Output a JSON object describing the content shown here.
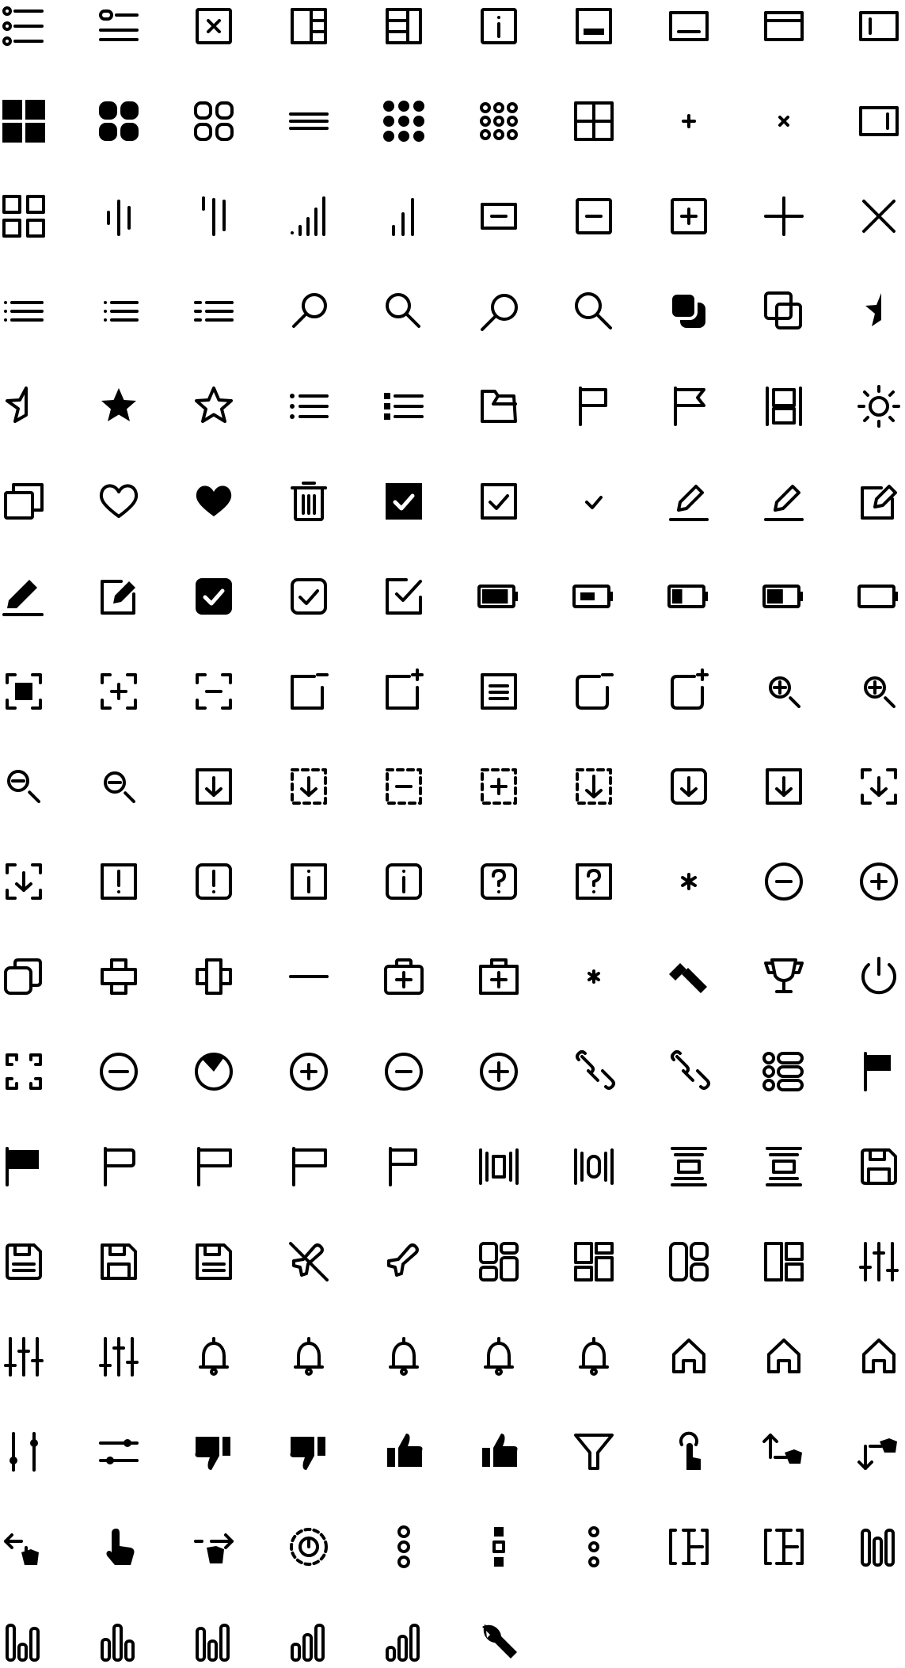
{
  "sheet": {
    "background": "#ffffff",
    "ink": "#000000",
    "icons": [
      "list-bulleted-icon",
      "list-header-icon",
      "close-box-icon",
      "layout-columns-icon",
      "layout-sidebar-icon",
      "info-box-icon",
      "panel-bottom-icon",
      "panel-bottom-outline-icon",
      "panel-top-icon",
      "panel-left-icon",
      "grid-filled-icon",
      "grid-rounded-filled-icon",
      "grid-rounded-outline-icon",
      "lines-icon",
      "grid-dots-filled-icon",
      "grid-dots-outline-icon",
      "grid-window-icon",
      "plus-small-icon",
      "close-small-icon",
      "panel-right-icon",
      "grid-outline-icon",
      "signal-low-icon",
      "signal-off-icon",
      "signal-bars-icon",
      "signal-bars-partial-icon",
      "minus-rect-icon",
      "minus-square-icon",
      "plus-square-icon",
      "plus-icon",
      "close-icon",
      "list-compact-icon",
      "list-dotted-icon",
      "list-dashed-icon",
      "search-left-icon",
      "search-right-icon",
      "search-left-large-icon",
      "search-right-large-icon",
      "copy-filled-icon",
      "copy-outline-icon",
      "star-half-filled-icon",
      "star-half-outline-icon",
      "star-filled-icon",
      "star-outline-icon",
      "list-bullets-icon",
      "list-bullets-bold-icon",
      "folder-open-icon",
      "flag-outline-icon",
      "flag-notch-icon",
      "layout-split-icon",
      "settings-sun-icon",
      "copy-stack-icon",
      "heart-outline-icon",
      "heart-filled-icon",
      "trash-icon",
      "checkbox-filled-icon",
      "checkbox-outline-icon",
      "check-icon",
      "pencil-underline-icon",
      "pencil-line-icon",
      "edit-square-icon",
      "pencil-filled-icon",
      "edit-box-icon",
      "checkbox-rounded-filled-icon",
      "checkbox-rounded-outline-icon",
      "checkbox-open-icon",
      "battery-filled-icon",
      "battery-half-icon",
      "battery-low-icon",
      "battery-mid-icon",
      "battery-empty-icon",
      "focus-square-icon",
      "focus-plus-icon",
      "focus-minus-icon",
      "window-minus-icon",
      "window-plus-icon",
      "document-lines-icon",
      "window-minus-rounded-icon",
      "window-plus-rounded-icon",
      "zoom-in-icon",
      "zoom-in-alt-icon",
      "zoom-out-icon",
      "zoom-out-alt-icon",
      "download-box-icon",
      "download-dashed-icon",
      "minus-dashed-icon",
      "plus-dashed-icon",
      "download-dashed-alt-icon",
      "download-rounded-icon",
      "download-square-icon",
      "download-focus-icon",
      "download-focus-alt-icon",
      "alert-box-icon",
      "alert-rounded-icon",
      "info-square-icon",
      "info-rounded-icon",
      "help-rounded-icon",
      "help-square-icon",
      "asterisk-icon",
      "minus-circle-icon",
      "plus-circle-icon",
      "copy-rounded-icon",
      "cross-rounded-icon",
      "cross-square-icon",
      "minus-icon",
      "medical-kit-icon",
      "medical-kit-alt-icon",
      "asterisk-small-icon",
      "hammer-icon",
      "trophy-icon",
      "power-icon",
      "fullscreen-icon",
      "minus-circle-bold-icon",
      "pie-circle-icon",
      "plus-circle-alt-icon",
      "minus-circle-alt-icon",
      "plus-circle-bold-icon",
      "link-icon",
      "link-alt-icon",
      "list-items-icon",
      "flag-filled-icon",
      "flag-filled-alt-icon",
      "flag-rounded-icon",
      "flag-outline-alt-icon",
      "flag-square-icon",
      "flag-thin-icon",
      "align-center-h-icon",
      "align-center-h-alt-icon",
      "align-center-v-icon",
      "align-center-v-alt-icon",
      "save-icon",
      "save-rounded-icon",
      "save-outline-icon",
      "save-lines-icon",
      "airplane-off-icon",
      "airplane-icon",
      "dashboard-icon",
      "dashboard-alt-icon",
      "layout-tiles-icon",
      "layout-tiles-alt-icon",
      "sliders-icon",
      "sliders-alt-icon",
      "sliders-thin-icon",
      "bell-icon",
      "bell-outline-icon",
      "bell-alt-icon",
      "bell-rounded-icon",
      "bell-thin-icon",
      "home-rounded-icon",
      "home-icon",
      "home-outline-icon",
      "slider-vertical-icon",
      "slider-horizontal-icon",
      "thumbs-down-icon",
      "thumbs-down-alt-icon",
      "thumbs-up-icon",
      "thumbs-up-alt-icon",
      "filter-icon",
      "tap-icon",
      "pointer-up-right-icon",
      "pointer-down-icon",
      "pointer-left-icon",
      "hand-pointer-icon",
      "pointer-right-icon",
      "rotate-dashed-icon",
      "more-vertical-icon",
      "more-vertical-square-icon",
      "more-vertical-outline-icon",
      "text-cursor-icon",
      "text-cursor-alt-icon",
      "chart-bars-rounded-icon",
      "chart-bars-icon",
      "chart-bars-alt-icon",
      "chart-bars-outline-icon",
      "chart-bars-rising-icon",
      "chart-bars-rising-alt-icon",
      "wrench-icon"
    ]
  }
}
